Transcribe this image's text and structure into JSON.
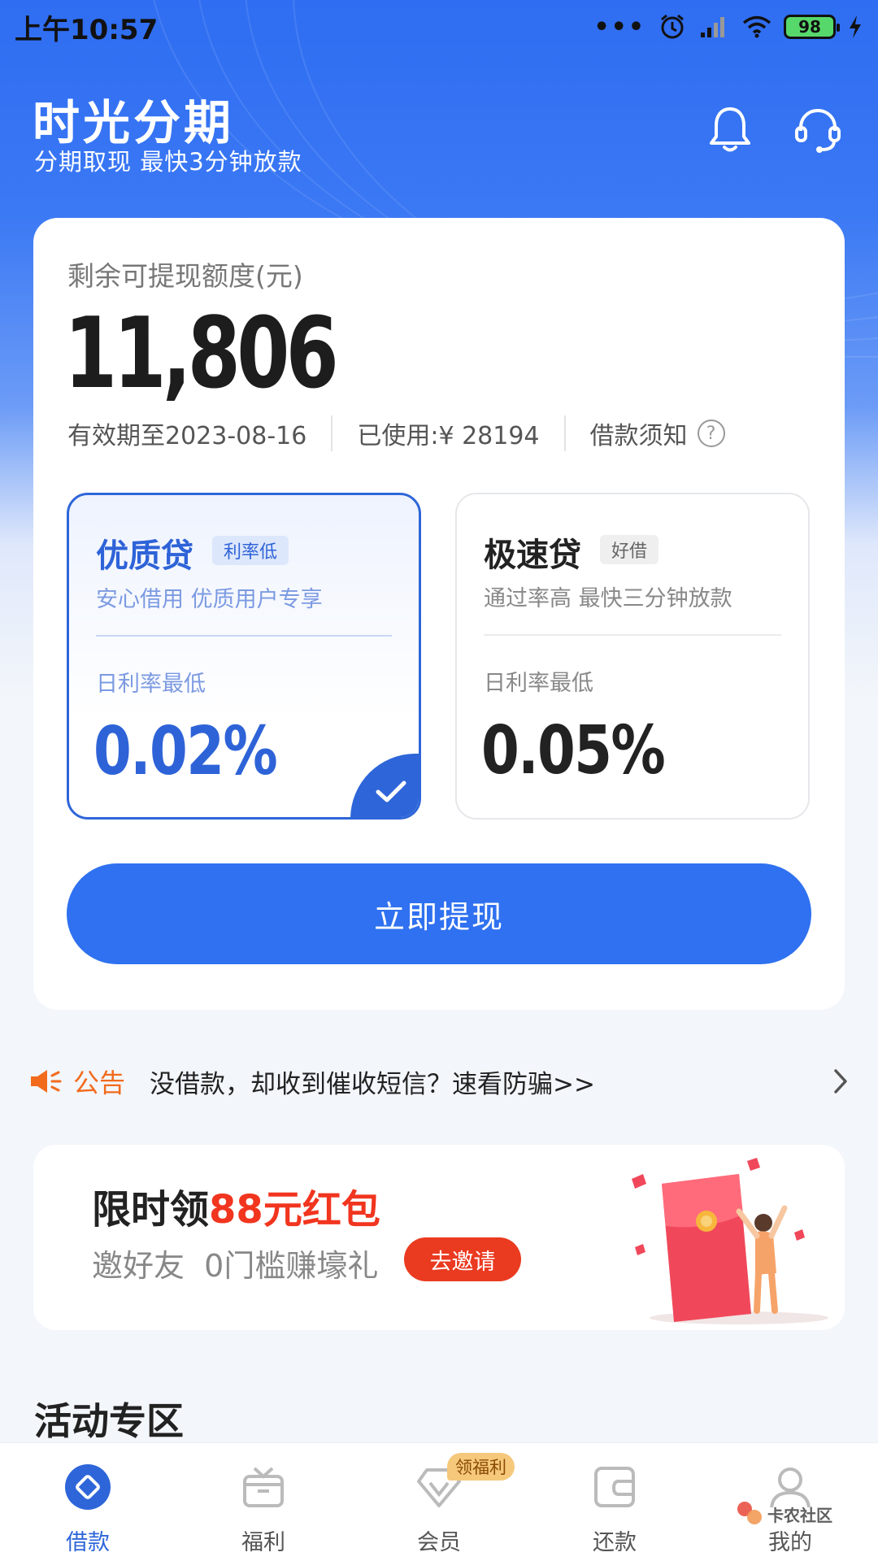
{
  "status_bar": {
    "time": "上午10:57",
    "dots": "•••",
    "battery": "98"
  },
  "header": {
    "title": "时光分期",
    "subtitle": "分期取现 最快3分钟放款"
  },
  "main": {
    "quota_label": "剩余可提现额度(元)",
    "quota_amount": "11,806",
    "valid_until": "有效期至2023-08-16",
    "used": "已使用:¥ 28194",
    "loan_notice": "借款须知",
    "help_glyph": "?",
    "loans": [
      {
        "name": "优质贷",
        "tag": "利率低",
        "desc": "安心借用 优质用户专享",
        "rate_label": "日利率最低",
        "rate": "0.02%",
        "selected": true
      },
      {
        "name": "极速贷",
        "tag": "好借",
        "desc": "通过率高 最快三分钟放款",
        "rate_label": "日利率最低",
        "rate": "0.05%",
        "selected": false
      }
    ],
    "withdraw_button": "立即提现"
  },
  "notice": {
    "label": "公告",
    "text": "没借款，却收到催收短信？速看防骗>>"
  },
  "promo": {
    "title_prefix": "限时领",
    "title_highlight": "88元红包",
    "subtitle": "邀好友  0门槛赚壕礼",
    "button": "去邀请"
  },
  "section_title": "活动专区",
  "bottom_nav": {
    "items": [
      {
        "label": "借款",
        "icon": "loan-icon",
        "active": true
      },
      {
        "label": "福利",
        "icon": "gift-icon",
        "active": false
      },
      {
        "label": "会员",
        "icon": "diamond-icon",
        "active": false,
        "badge": "领福利"
      },
      {
        "label": "还款",
        "icon": "wallet-icon",
        "active": false
      },
      {
        "label": "我的",
        "icon": "user-icon",
        "active": false
      }
    ]
  },
  "watermark": {
    "text": "卡农社区"
  },
  "colors": {
    "brand_blue": "#2f71f0",
    "selected_blue": "#2e63d8",
    "notice_orange": "#f26b1d",
    "promo_red": "#f1351f"
  }
}
